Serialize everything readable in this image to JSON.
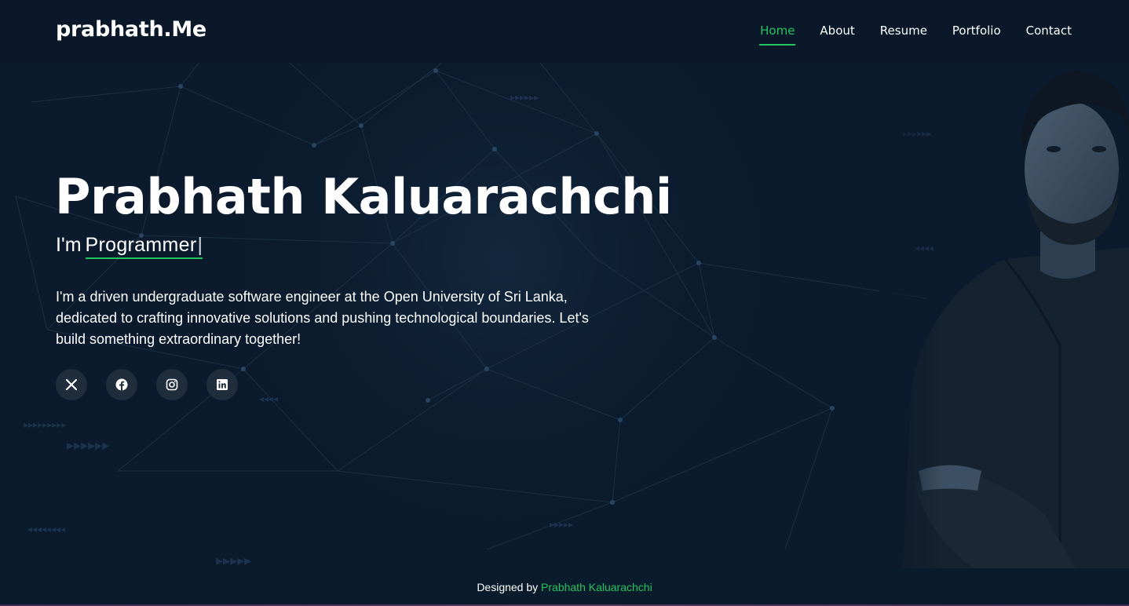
{
  "brand": {
    "logo": "prabhath.Me"
  },
  "nav": {
    "items": [
      {
        "label": "Home",
        "active": true
      },
      {
        "label": "About",
        "active": false
      },
      {
        "label": "Resume",
        "active": false
      },
      {
        "label": "Portfolio",
        "active": false
      },
      {
        "label": "Contact",
        "active": false
      }
    ]
  },
  "hero": {
    "name": "Prabhath Kaluarachchi",
    "role_prefix": "I'm",
    "role_typed": "Programmer",
    "cursor": "|",
    "description": "I'm a driven undergraduate software engineer at the Open University of Sri Lanka, dedicated to crafting innovative solutions and pushing technological boundaries. Let's build something extraordinary together!"
  },
  "socials": [
    {
      "icon": "x-twitter-icon"
    },
    {
      "icon": "facebook-icon"
    },
    {
      "icon": "instagram-icon"
    },
    {
      "icon": "linkedin-icon"
    }
  ],
  "footer": {
    "prefix": "Designed by",
    "author": "Prabhath Kaluarachchi"
  },
  "colors": {
    "accent": "#22c55e",
    "background": "#0b1a2c",
    "social_bg": "#1f2d3d"
  }
}
